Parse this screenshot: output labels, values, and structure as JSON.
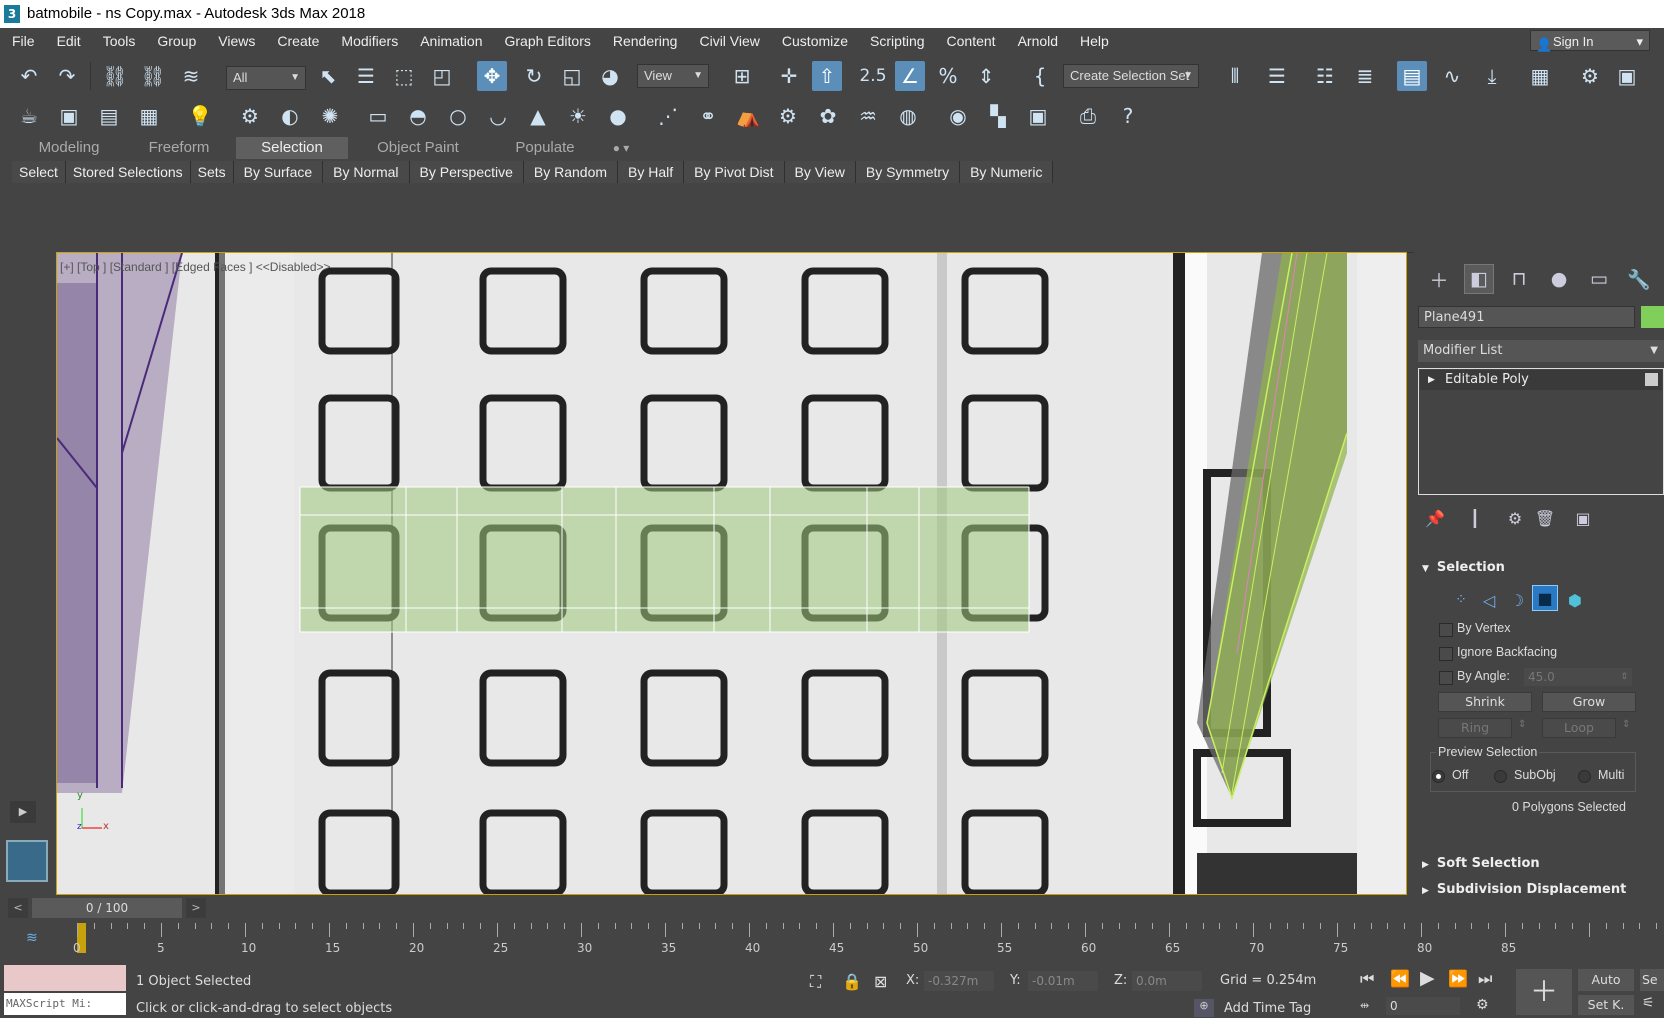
{
  "title": {
    "icon_text": "3",
    "text": "batmobile - ns Copy.max - Autodesk 3ds Max 2018"
  },
  "menu": [
    "File",
    "Edit",
    "Tools",
    "Group",
    "Views",
    "Create",
    "Modifiers",
    "Animation",
    "Graph Editors",
    "Rendering",
    "Civil View",
    "Customize",
    "Scripting",
    "Content",
    "Arnold",
    "Help"
  ],
  "signin": "Sign In",
  "toolbar": {
    "filter": "All",
    "refcoord": "View",
    "snap_label": "2.5",
    "selset": "Create Selection Set"
  },
  "ribbon": {
    "tabs": [
      "Modeling",
      "Freeform",
      "Selection",
      "Object Paint",
      "Populate"
    ],
    "active_tab": "Selection",
    "tools": [
      "Select",
      "Stored Selections",
      "Sets",
      "By Surface",
      "By Normal",
      "By Perspective",
      "By Random",
      "By Half",
      "By Pivot Dist",
      "By View",
      "By Symmetry",
      "By Numeric"
    ]
  },
  "viewport": {
    "label": "[+] [Top ] [Standard ] [Edged Faces ]  <<Disabled>>",
    "axis_y": "y",
    "axis_x": "x",
    "axis_z": "z"
  },
  "command_panel": {
    "object_name": "Plane491",
    "object_color": "#7fcf5a",
    "modifier_list": "Modifier List",
    "stack": [
      "Editable Poly"
    ],
    "selection": {
      "title": "Selection",
      "by_vertex": "By Vertex",
      "ignore_backfacing": "Ignore Backfacing",
      "by_angle": "By Angle:",
      "angle_value": "45.0",
      "shrink": "Shrink",
      "grow": "Grow",
      "ring": "Ring",
      "loop": "Loop",
      "preview_title": "Preview Selection",
      "preview_options": [
        "Off",
        "SubObj",
        "Multi"
      ],
      "preview_selected": "Off",
      "status": "0 Polygons Selected"
    },
    "soft_selection": "Soft Selection",
    "subdivision": "Subdivision Displacement"
  },
  "timeline": {
    "frame": "0 / 100",
    "ticks": [
      "0",
      "5",
      "10",
      "15",
      "20",
      "25",
      "30",
      "35",
      "40",
      "45",
      "50",
      "55",
      "60",
      "65",
      "70",
      "75",
      "80",
      "85"
    ]
  },
  "status": {
    "maxscript": "MAXScript Mi:",
    "selected": "1 Object Selected",
    "prompt": "Click or click-and-drag to select objects",
    "x_label": "X:",
    "x": "-0.327m",
    "y_label": "Y:",
    "y": "-0.01m",
    "z_label": "Z:",
    "z": "0.0m",
    "grid": "Grid = 0.254m",
    "add_time_tag": "Add Time Tag",
    "auto": "Auto",
    "setkey": "Set K.",
    "frame_field": "0",
    "se": "Se"
  }
}
